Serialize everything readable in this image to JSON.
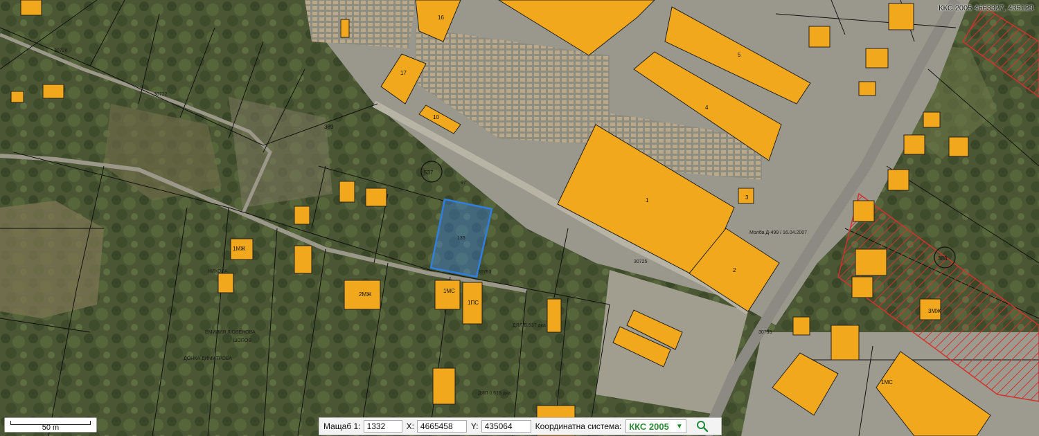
{
  "map": {
    "coords_display": "ККС 2005 4663327, 435129",
    "scale_label": "50 m"
  },
  "toolbar": {
    "scale_label": "Мащаб 1:",
    "scale_value": "1332",
    "x_label": "X:",
    "x_value": "4665458",
    "y_label": "Y:",
    "y_value": "435064",
    "crs_label": "Координатна система:",
    "crs_value": "ККС 2005",
    "dropdown_icon": "chevron-down-icon",
    "search_icon": "search-icon"
  },
  "labels": {
    "buildings": [
      "16",
      "17",
      "10",
      "1",
      "4",
      "5",
      "2",
      "3",
      "1МС",
      "1МЖ",
      "2МЖ",
      "3МЖ",
      "1МС",
      "1ПС"
    ],
    "roads": [
      "30726",
      "30722",
      "30725",
      "30733",
      "30753"
    ],
    "plots": [
      "389",
      "537",
      "383",
      "135",
      "97"
    ],
    "text": [
      "Молба Д-499 / 16.04.2007",
      "ДЯЛ В.537 дка",
      "ДЯЛ 0.615 дка",
      "НИКОЛА",
      "ЕМИЛИЯ ЛЮБЕНОВА",
      "ШОПОВ",
      "ДОНКА ДИМИТРОВА"
    ]
  },
  "colors": {
    "building": "#f2a81d",
    "selection": "#2f7fe0",
    "hatch": "#d3322c"
  }
}
